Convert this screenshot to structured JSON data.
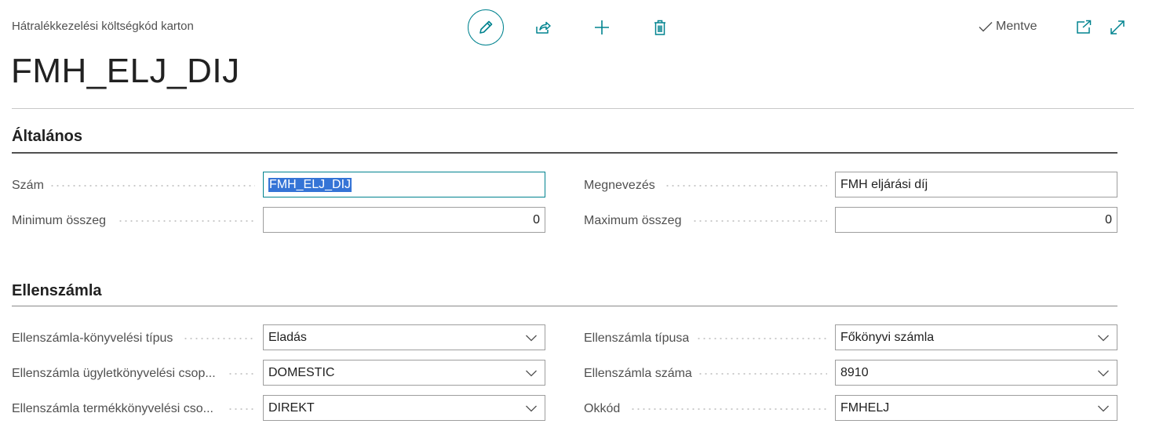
{
  "header": {
    "page_type": "Hátralékkezelési költségkód karton",
    "record_title": "FMH_ELJ_DIJ",
    "saved_label": "Mentve"
  },
  "toolbar": {
    "edit_icon": "pencil-icon",
    "share_icon": "share-icon",
    "new_icon": "plus-icon",
    "delete_icon": "trash-icon"
  },
  "accent_color": "#00838f",
  "sections": {
    "general": {
      "title": "Általános",
      "szam_label": "Szám",
      "szam_value": "FMH_ELJ_DIJ",
      "megnevezes_label": "Megnevezés",
      "megnevezes_value": "FMH eljárási díj",
      "min_label": "Minimum összeg",
      "min_value": "0",
      "max_label": "Maximum összeg",
      "max_value": "0"
    },
    "balancing": {
      "title": "Ellenszámla",
      "kony_tipus_label": "Ellenszámla-könyvelési típus",
      "kony_tipus_value": "Eladás",
      "tipus_label": "Ellenszámla típusa",
      "tipus_value": "Főkönyvi számla",
      "ugylet_label": "Ellenszámla ügyletkönyvelési csop...",
      "ugylet_value": "DOMESTIC",
      "szama_label": "Ellenszámla száma",
      "szama_value": "8910",
      "termek_label": "Ellenszámla termékkönyvelési cso...",
      "termek_value": "DIREKT",
      "okkod_label": "Okkód",
      "okkod_value": "FMHELJ"
    }
  }
}
